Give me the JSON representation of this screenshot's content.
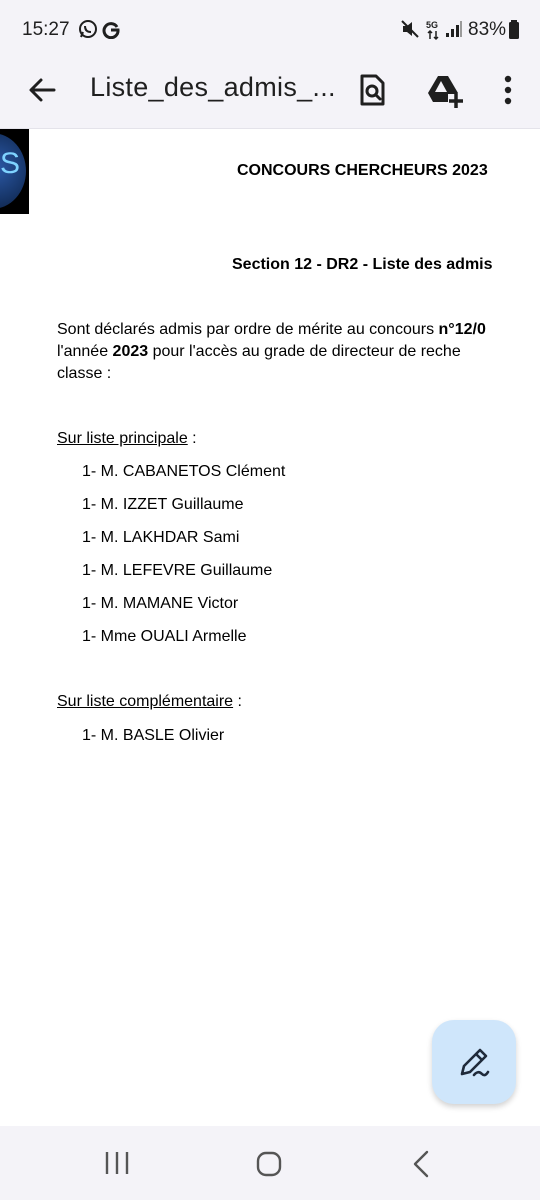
{
  "status_bar": {
    "time": "15:27",
    "left_icons": [
      "whatsapp-icon",
      "google-icon"
    ],
    "right_icons": [
      "mute-icon",
      "5g-icon",
      "signal-icon",
      "battery-icon"
    ],
    "network": "5G",
    "battery": "83%"
  },
  "app_bar": {
    "title": "Liste_des_admis_...",
    "actions": [
      "search-document-icon",
      "add-to-drive-icon",
      "more-vert-icon"
    ]
  },
  "document": {
    "title": "CONCOURS CHERCHEURS 2023",
    "subtitle": "Section 12 - DR2 - Liste des admis",
    "intro": {
      "line1_text": "Sont déclarés admis par ordre de mérite au concours ",
      "line1_bold": "n°12/0",
      "line2_pre": "l'année ",
      "line2_bold": "2023",
      "line2_post": " pour l'accès au grade de directeur de reche",
      "line3": "classe :"
    },
    "principal": {
      "heading": "Sur liste principale",
      "suffix": " :",
      "entries": [
        "1- M. CABANETOS Clément",
        "1- M. IZZET Guillaume",
        "1- M. LAKHDAR Sami",
        "1- M. LEFEVRE Guillaume",
        "1- M. MAMANE Victor",
        "1- Mme OUALI Armelle"
      ]
    },
    "complementary": {
      "heading": "Sur liste complémentaire",
      "suffix": " :",
      "entries": [
        "1- M. BASLE Olivier"
      ]
    }
  },
  "colors": {
    "bar_background": "#f4f3f8",
    "fab_background": "#cfe6fb",
    "icon": "#1f1f1f"
  }
}
